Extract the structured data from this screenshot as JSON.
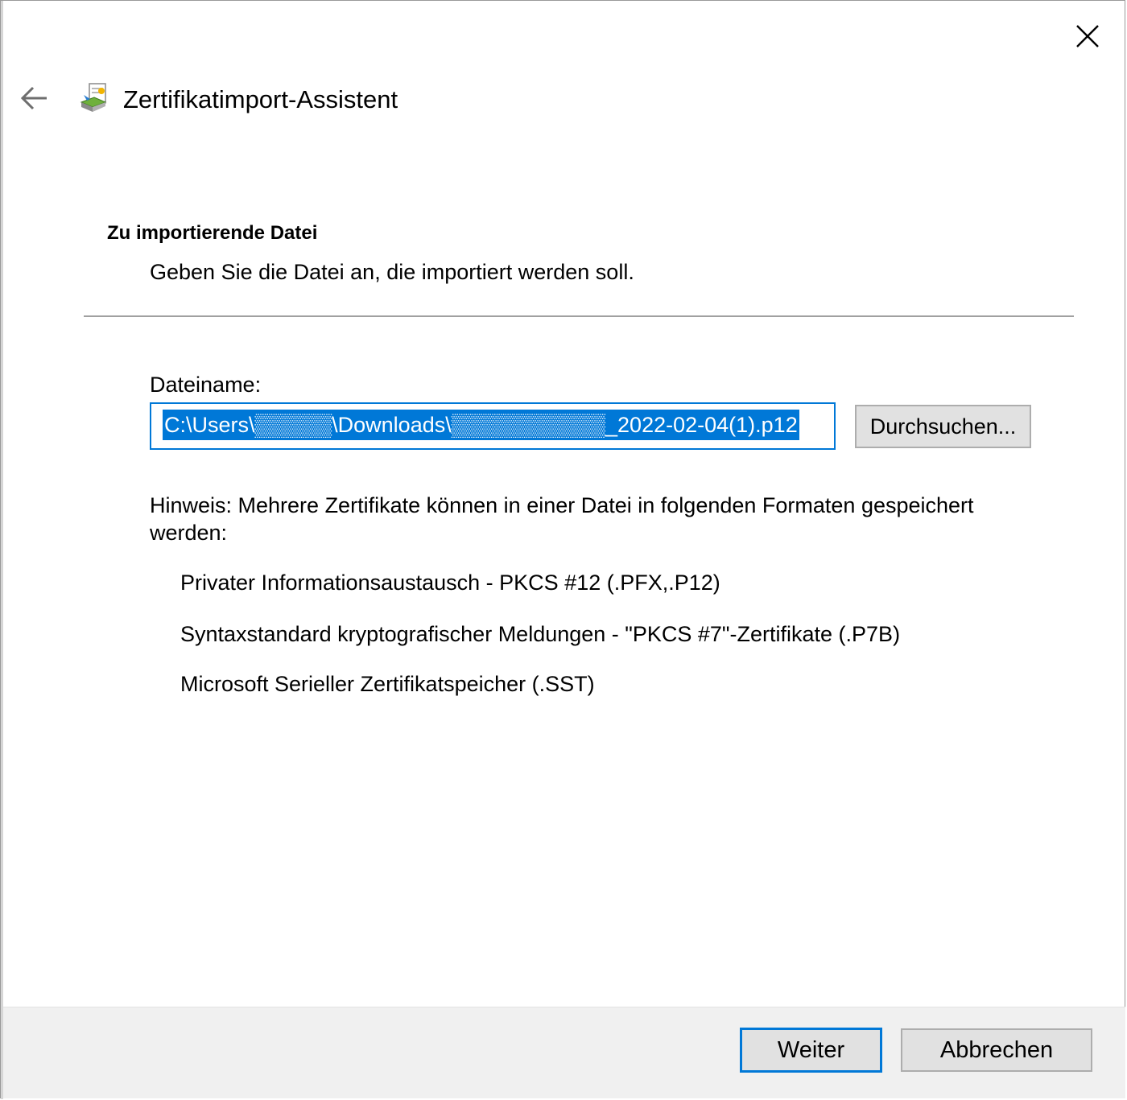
{
  "window": {
    "title": "Zertifikatimport-Assistent",
    "accent_color": "#0078d7"
  },
  "icons": {
    "back": "arrow-left-icon",
    "close": "close-x-icon",
    "wizard": "certificate-wizard-icon"
  },
  "section": {
    "heading": "Zu importierende Datei",
    "subtitle": "Geben Sie die Datei an, die importiert werden soll."
  },
  "file_field": {
    "label": "Dateiname:",
    "value": "C:\\Users\\▒▒▒▒▒\\Downloads\\▒▒▒▒▒▒▒▒▒▒_2022-02-04(1).p12",
    "browse_label": "Durchsuchen..."
  },
  "hint": {
    "text": "Hinweis: Mehrere Zertifikate können in einer Datei in folgenden Formaten gespeichert werden:",
    "formats": [
      "Privater Informationsaustausch - PKCS #12 (.PFX,.P12)",
      "Syntaxstandard kryptografischer Meldungen - \"PKCS #7\"-Zertifikate (.P7B)",
      "Microsoft Serieller Zertifikatspeicher (.SST)"
    ]
  },
  "footer": {
    "next_label": "Weiter",
    "cancel_label": "Abbrechen"
  }
}
